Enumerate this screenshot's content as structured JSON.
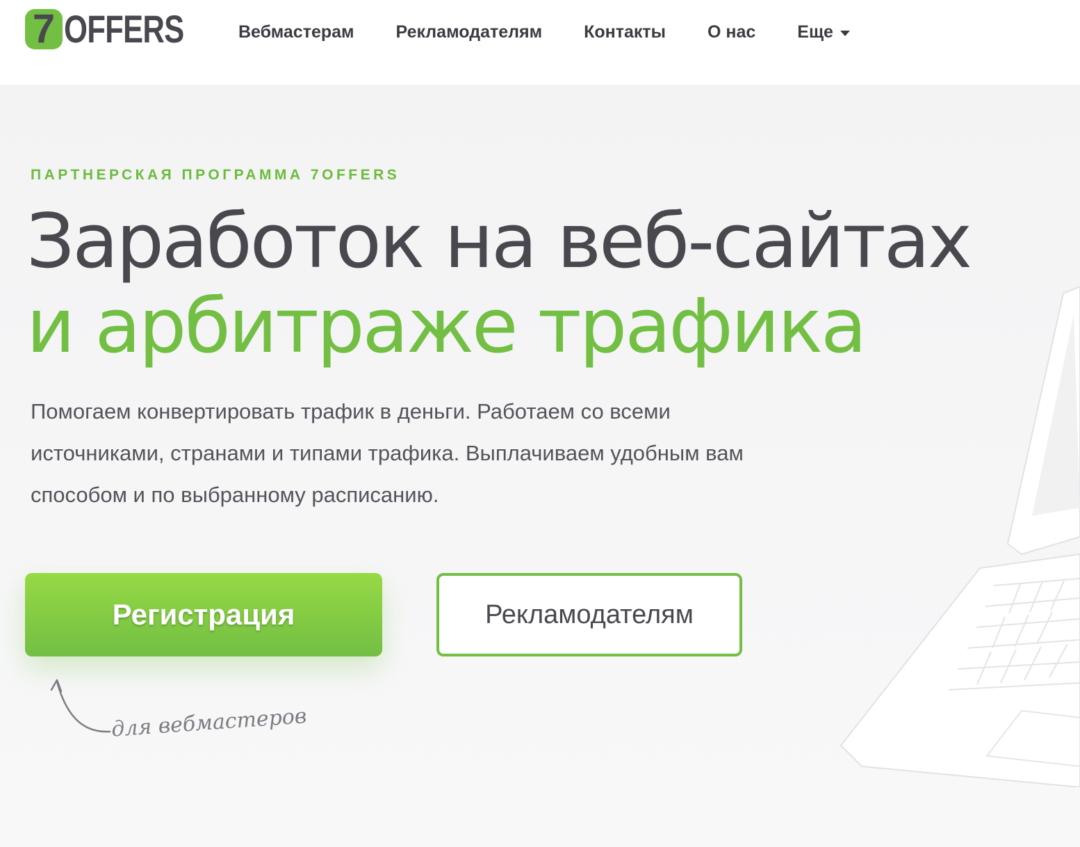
{
  "header": {
    "logo": {
      "mark": "7",
      "text": "OFFERS"
    },
    "nav": [
      {
        "label": "Вебмастерам"
      },
      {
        "label": "Рекламодателям"
      },
      {
        "label": "Контакты"
      },
      {
        "label": "О нас"
      },
      {
        "label": "Еще",
        "icon": "caret-down-icon"
      }
    ]
  },
  "hero": {
    "eyebrow": "ПАРТНЕРСКАЯ ПРОГРАММА 7OFFERS",
    "title_line1": "Заработок на веб-сайтах",
    "title_line2": "и арбитраже трафика",
    "description": "Помогаем конвертировать трафик в деньги. Работаем со всеми источниками, странами и типами трафика. Выплачиваем удобным вам способом и по выбранному расписанию.",
    "register_button": "Регистрация",
    "advertisers_button": "Рекламодателям",
    "register_note": "для вебмастеров"
  },
  "colors": {
    "accent": "#72bf44",
    "text_dark": "#4a484f",
    "background": "#f6f6f7"
  }
}
